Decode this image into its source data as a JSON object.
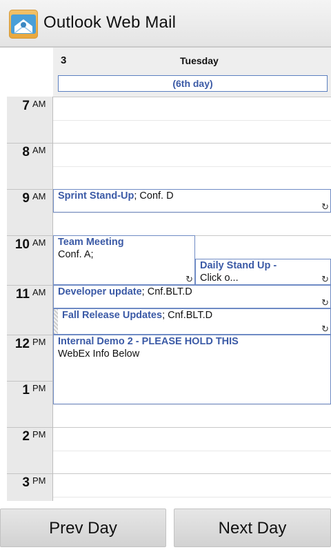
{
  "app": {
    "title": "Outlook Web Mail",
    "icon": "mail-envelope-icon"
  },
  "day_header": {
    "date_number": "3",
    "weekday": "Tuesday",
    "all_day_label": "(6th day)"
  },
  "hours": [
    {
      "hour": "7",
      "ampm": "AM"
    },
    {
      "hour": "8",
      "ampm": "AM"
    },
    {
      "hour": "9",
      "ampm": "AM"
    },
    {
      "hour": "10",
      "ampm": "AM"
    },
    {
      "hour": "11",
      "ampm": "AM"
    },
    {
      "hour": "12",
      "ampm": "PM"
    },
    {
      "hour": "1",
      "ampm": "PM"
    },
    {
      "hour": "2",
      "ampm": "PM"
    },
    {
      "hour": "3",
      "ampm": "PM"
    }
  ],
  "events": {
    "sprint": {
      "title": "Sprint Stand-Up",
      "location": "; Conf. D"
    },
    "team": {
      "title": "Team Meeting",
      "location": "Conf. A;"
    },
    "daily": {
      "title": "Daily Stand Up -",
      "location": "Click o..."
    },
    "devupdate": {
      "title": "Developer update",
      "location": "; Cnf.BLT.D"
    },
    "fall": {
      "title": "Fall Release Updates",
      "location": "; Cnf.BLT.D"
    },
    "demo": {
      "title": "Internal Demo 2 - PLEASE HOLD THIS",
      "location": "WebEx Info Below"
    }
  },
  "recurring_icon": "sync-recurring-icon",
  "buttons": {
    "prev": "Prev Day",
    "next": "Next Day"
  },
  "colors": {
    "event_border": "#6e8ac4",
    "event_title": "#3b5aa6"
  }
}
